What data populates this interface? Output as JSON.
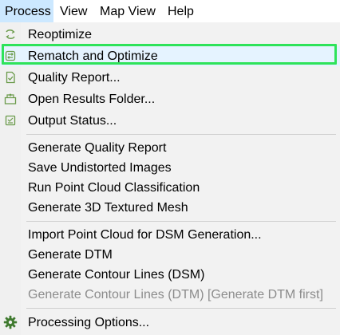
{
  "menubar": {
    "items": [
      {
        "label": "Process",
        "active": true
      },
      {
        "label": "View",
        "active": false
      },
      {
        "label": "Map View",
        "active": false
      },
      {
        "label": "Help",
        "active": false
      }
    ]
  },
  "menu": {
    "items": [
      {
        "label": "Reoptimize",
        "icon": "reoptimize-icon",
        "enabled": true
      },
      {
        "label": "Rematch and Optimize",
        "icon": "rematch-icon",
        "enabled": true,
        "highlighted": true
      },
      {
        "label": "Quality Report...",
        "icon": "quality-report-icon",
        "enabled": true
      },
      {
        "label": "Open Results Folder...",
        "icon": "open-folder-icon",
        "enabled": true
      },
      {
        "label": "Output Status...",
        "icon": "output-status-icon",
        "enabled": true
      },
      {
        "label": "Generate Quality Report",
        "enabled": true
      },
      {
        "label": "Save Undistorted Images",
        "enabled": true
      },
      {
        "label": "Run Point Cloud Classification",
        "enabled": true
      },
      {
        "label": "Generate 3D Textured Mesh",
        "enabled": true
      },
      {
        "label": "Import Point Cloud for DSM Generation...",
        "enabled": true
      },
      {
        "label": "Generate DTM",
        "enabled": true
      },
      {
        "label": "Generate Contour Lines (DSM)",
        "enabled": true
      },
      {
        "label": "Generate Contour Lines (DTM) [Generate DTM first]",
        "enabled": false
      },
      {
        "label": "Processing Options...",
        "icon": "gear-icon",
        "enabled": true
      }
    ]
  },
  "colors": {
    "highlight_ring": "#2ee35a",
    "active_menubar": "#cce8ff",
    "gear_icon": "#3f7a2f"
  }
}
